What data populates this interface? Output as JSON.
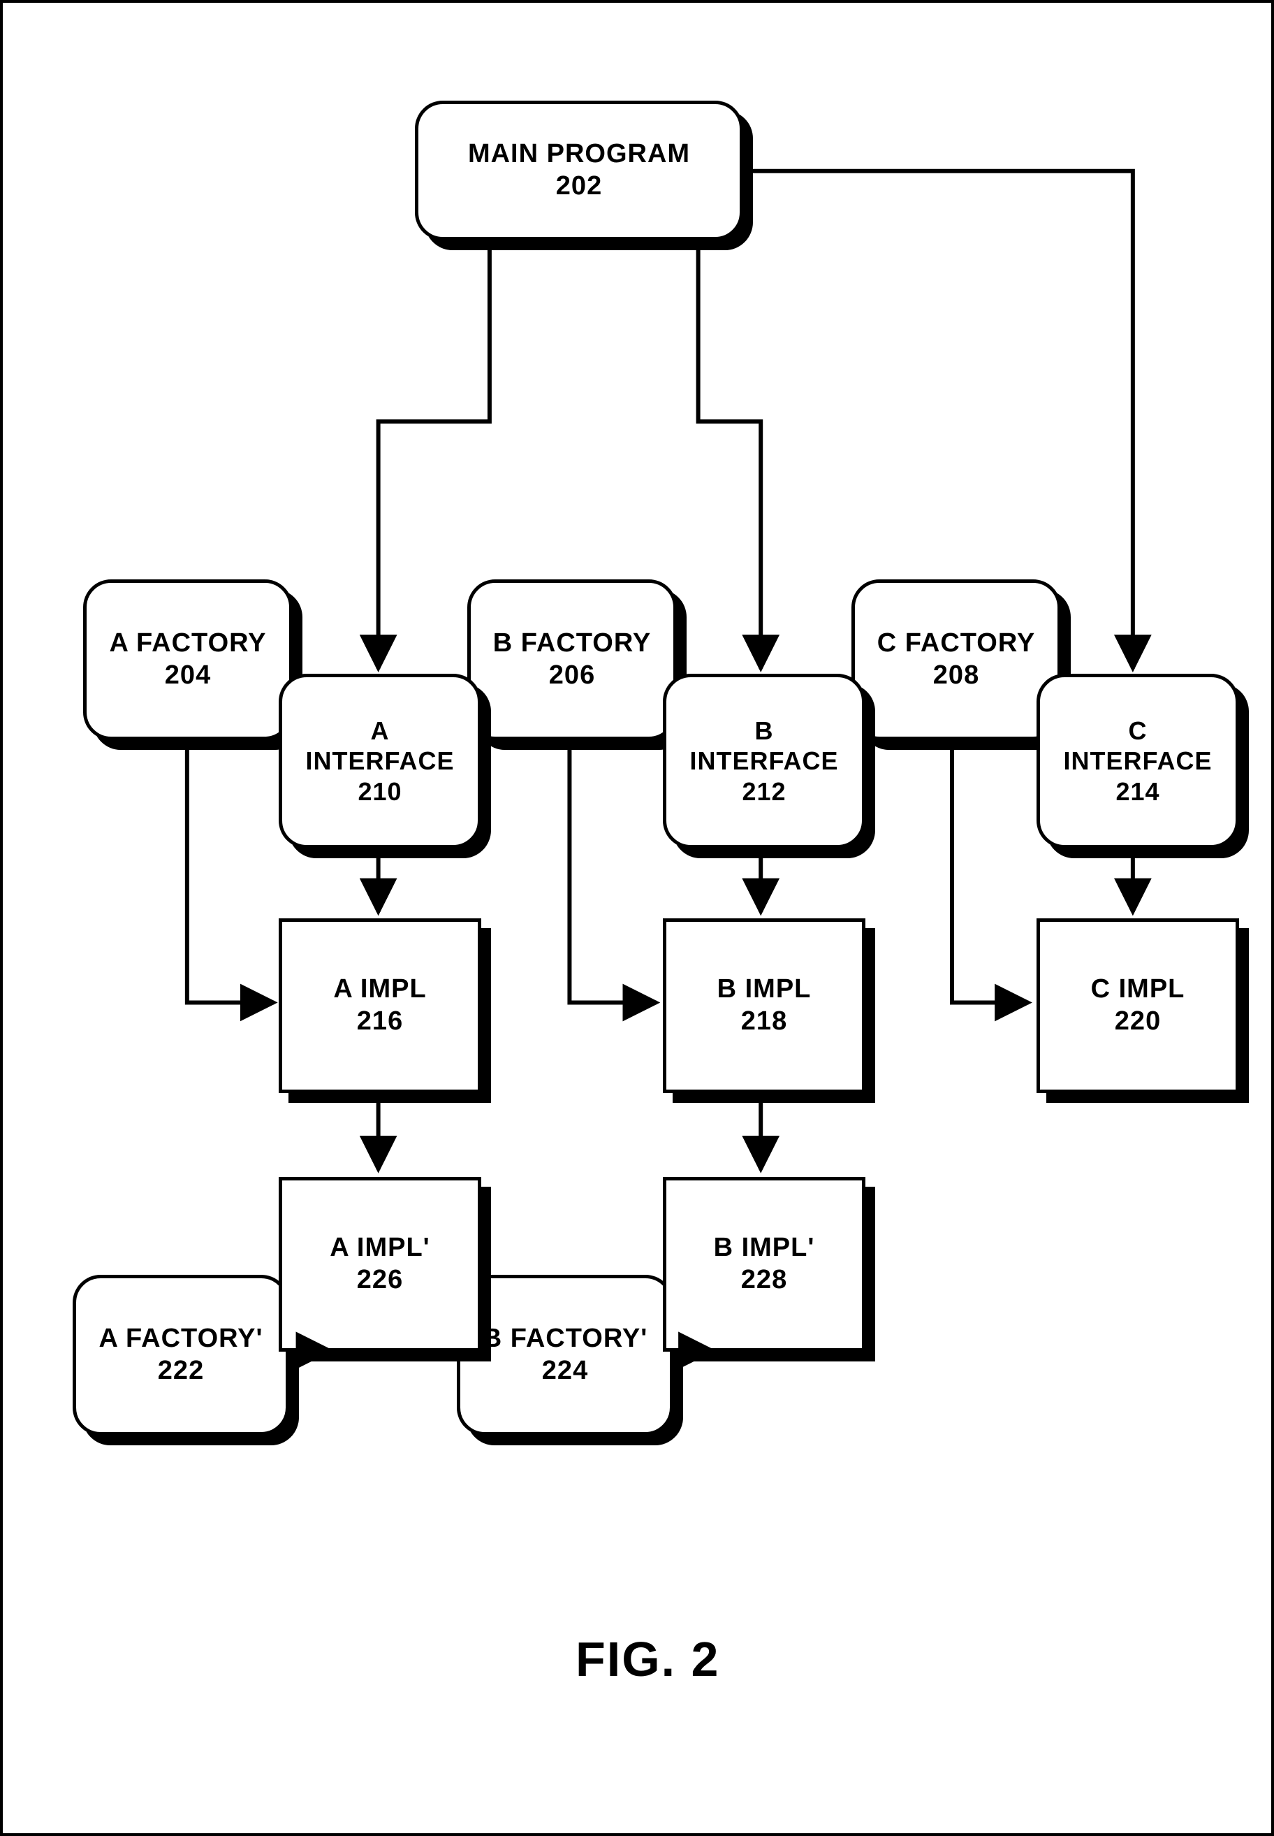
{
  "figure_label": "FIG. 2",
  "nodes": {
    "main_program": {
      "label": "MAIN PROGRAM",
      "ref": "202"
    },
    "a_factory": {
      "label": "A FACTORY",
      "ref": "204"
    },
    "b_factory": {
      "label": "B FACTORY",
      "ref": "206"
    },
    "c_factory": {
      "label": "C FACTORY",
      "ref": "208"
    },
    "a_interface": {
      "label": "A INTERFACE",
      "ref": "210"
    },
    "b_interface": {
      "label": "B INTERFACE",
      "ref": "212"
    },
    "c_interface": {
      "label": "C INTERFACE",
      "ref": "214"
    },
    "a_impl": {
      "label": "A IMPL",
      "ref": "216"
    },
    "b_impl": {
      "label": "B IMPL",
      "ref": "218"
    },
    "c_impl": {
      "label": "C IMPL",
      "ref": "220"
    },
    "a_factory_p": {
      "label": "A FACTORY'",
      "ref": "222"
    },
    "b_factory_p": {
      "label": "B FACTORY'",
      "ref": "224"
    },
    "a_impl_p": {
      "label": "A IMPL'",
      "ref": "226"
    },
    "b_impl_p": {
      "label": "B IMPL'",
      "ref": "228"
    }
  },
  "chart_data": {
    "type": "diagram",
    "title": "FIG. 2",
    "nodes": [
      {
        "id": "202",
        "label": "MAIN PROGRAM",
        "shape": "rounded-rect"
      },
      {
        "id": "204",
        "label": "A FACTORY",
        "shape": "rounded-rect"
      },
      {
        "id": "206",
        "label": "B FACTORY",
        "shape": "rounded-rect"
      },
      {
        "id": "208",
        "label": "C FACTORY",
        "shape": "rounded-rect"
      },
      {
        "id": "210",
        "label": "A INTERFACE",
        "shape": "rounded-rect"
      },
      {
        "id": "212",
        "label": "B INTERFACE",
        "shape": "rounded-rect"
      },
      {
        "id": "214",
        "label": "C INTERFACE",
        "shape": "rounded-rect"
      },
      {
        "id": "216",
        "label": "A IMPL",
        "shape": "rect"
      },
      {
        "id": "218",
        "label": "B IMPL",
        "shape": "rect"
      },
      {
        "id": "220",
        "label": "C IMPL",
        "shape": "rect"
      },
      {
        "id": "222",
        "label": "A FACTORY'",
        "shape": "rounded-rect"
      },
      {
        "id": "224",
        "label": "B FACTORY'",
        "shape": "rounded-rect"
      },
      {
        "id": "226",
        "label": "A IMPL'",
        "shape": "rect"
      },
      {
        "id": "228",
        "label": "B IMPL'",
        "shape": "rect"
      }
    ],
    "edges": [
      {
        "from": "202",
        "to": "210"
      },
      {
        "from": "202",
        "to": "212"
      },
      {
        "from": "202",
        "to": "214"
      },
      {
        "from": "210",
        "to": "216"
      },
      {
        "from": "212",
        "to": "218"
      },
      {
        "from": "214",
        "to": "220"
      },
      {
        "from": "204",
        "to": "216"
      },
      {
        "from": "206",
        "to": "218"
      },
      {
        "from": "208",
        "to": "220"
      },
      {
        "from": "216",
        "to": "226"
      },
      {
        "from": "218",
        "to": "228"
      },
      {
        "from": "222",
        "to": "226"
      },
      {
        "from": "224",
        "to": "228"
      }
    ]
  }
}
